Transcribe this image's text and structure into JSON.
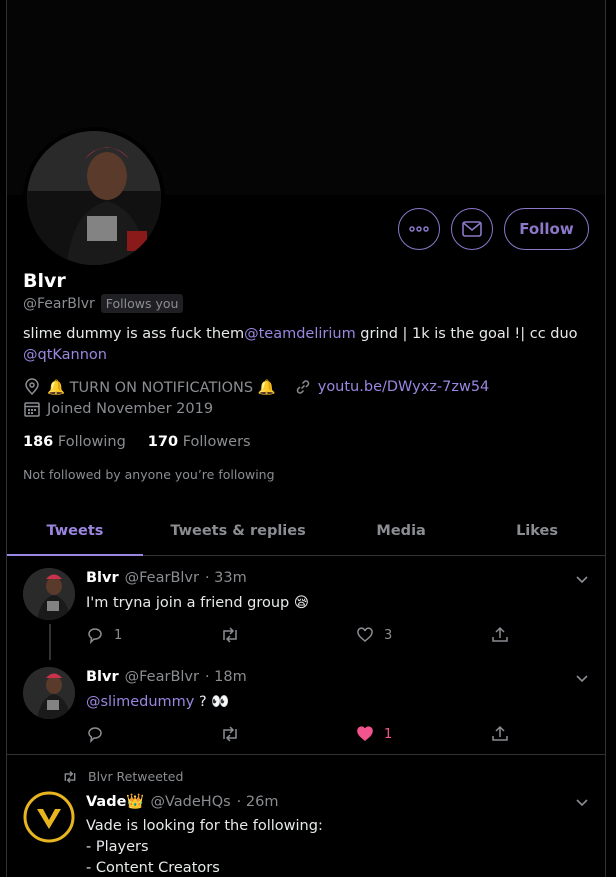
{
  "profile": {
    "name": "Blvr",
    "handle": "@FearBlvr",
    "follows_you": "Follows you",
    "bio_prefix": "slime dummy is ass fuck them",
    "bio_mention1": "@teamdelirium",
    "bio_middle": " grind | 1k is the goal !| cc duo",
    "bio_mention2": "@qtKannon",
    "location": "🔔 TURN ON NOTIFICATIONS 🔔",
    "website": "youtu.be/DWyxz-7zw54",
    "joined": "Joined November 2019",
    "following_count": "186",
    "following_label": "Following",
    "followers_count": "170",
    "followers_label": "Followers",
    "not_followed": "Not followed by anyone you’re following",
    "follow_button": "Follow"
  },
  "tabs": [
    {
      "label": "Tweets"
    },
    {
      "label": "Tweets & replies"
    },
    {
      "label": "Media"
    },
    {
      "label": "Likes"
    }
  ],
  "tweets": [
    {
      "name": "Blvr",
      "handle": "@FearBlvr",
      "time": "· 33m",
      "text": "I'm tryna join a friend group 😪",
      "replies": "1",
      "retweets": "",
      "likes": "3"
    },
    {
      "name": "Blvr",
      "handle": "@FearBlvr",
      "time": "· 18m",
      "mention": "@slimedummy",
      "text": " ? 👀",
      "replies": "",
      "retweets": "",
      "likes": "1"
    },
    {
      "retweeted_by": "Blvr Retweeted",
      "name": "Vade👑",
      "handle": "@VadeHQs",
      "time": "· 26m",
      "line1": "Vade is looking for the following:",
      "line2": "- Players",
      "line3": "- Content Creators"
    }
  ],
  "colors": {
    "accent": "#9b86e0",
    "liked": "#f4548e",
    "background": "#000000",
    "vade_gold": "#e8b520"
  }
}
